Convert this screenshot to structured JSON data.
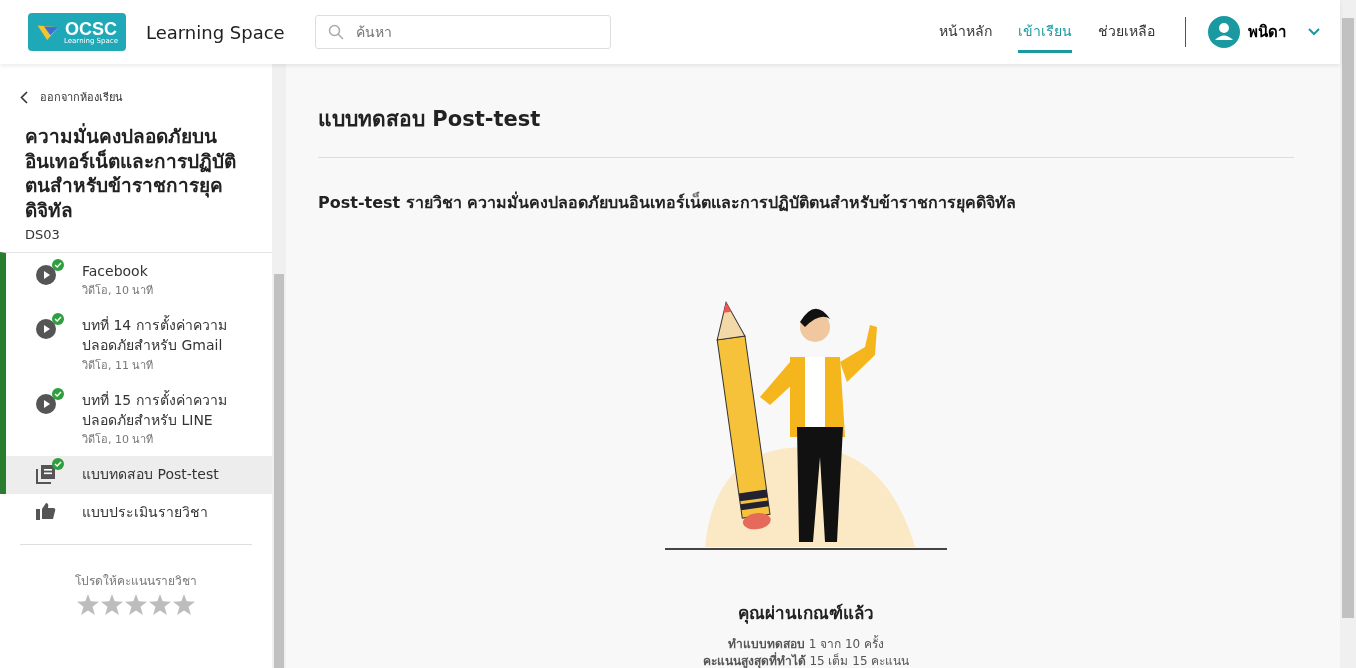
{
  "header": {
    "logo": {
      "title": "OCSC",
      "subtitle": "Learning Space"
    },
    "site_name": "Learning Space",
    "search": {
      "placeholder": "ค้นหา"
    },
    "nav": [
      {
        "label": "หน้าหลัก",
        "selected": false
      },
      {
        "label": "เข้าเรียน",
        "selected": true
      },
      {
        "label": "ช่วยเหลือ",
        "selected": false
      }
    ],
    "user": {
      "name": "พนิดา"
    }
  },
  "sidebar": {
    "back_link": "ออกจากห้องเรียน",
    "course_title": "ความมั่นคงปลอดภัยบนอินเทอร์เน็ตและการปฏิบัติตนสำหรับข้าราชการยุคดิจิทัล",
    "course_code": "DS03",
    "lessons": [
      {
        "kind": "video",
        "title": "Facebook",
        "meta": "วิดีโอ, 10 นาที",
        "done": true,
        "selected": false
      },
      {
        "kind": "video",
        "title": "บทที่ 14 การตั้งค่าความปลอดภัยสำหรับ Gmail",
        "meta": "วิดีโอ, 11 นาที",
        "done": true,
        "selected": false
      },
      {
        "kind": "video",
        "title": "บทที่ 15 การตั้งค่าความปลอดภัยสำหรับ LINE",
        "meta": "วิดีโอ, 10 นาที",
        "done": true,
        "selected": false
      },
      {
        "kind": "quiz",
        "title": "แบบทดสอบ Post-test",
        "done": true,
        "selected": true
      },
      {
        "kind": "survey",
        "title": "แบบประเมินรายวิชา",
        "done": false,
        "selected": false
      }
    ],
    "rating": {
      "prompt": "โปรดให้คะแนนรายวิชา",
      "stars": 0
    }
  },
  "main": {
    "title": "แบบทดสอบ Post-test",
    "subtitle": "Post-test รายวิชา ความมั่นคงปลอดภัยบนอินเทอร์เน็ตและการปฏิบัติตนสำหรับข้าราชการยุคดิจิทัล",
    "result": {
      "heading": "คุณผ่านเกณฑ์แล้ว",
      "lines": [
        "**ทำแบบทดสอบ** 1 จาก 10 ครั้ง",
        "**คะแนนสูงสุดที่ทำได้** 15 เต็ม 15 คะแนน"
      ]
    }
  }
}
